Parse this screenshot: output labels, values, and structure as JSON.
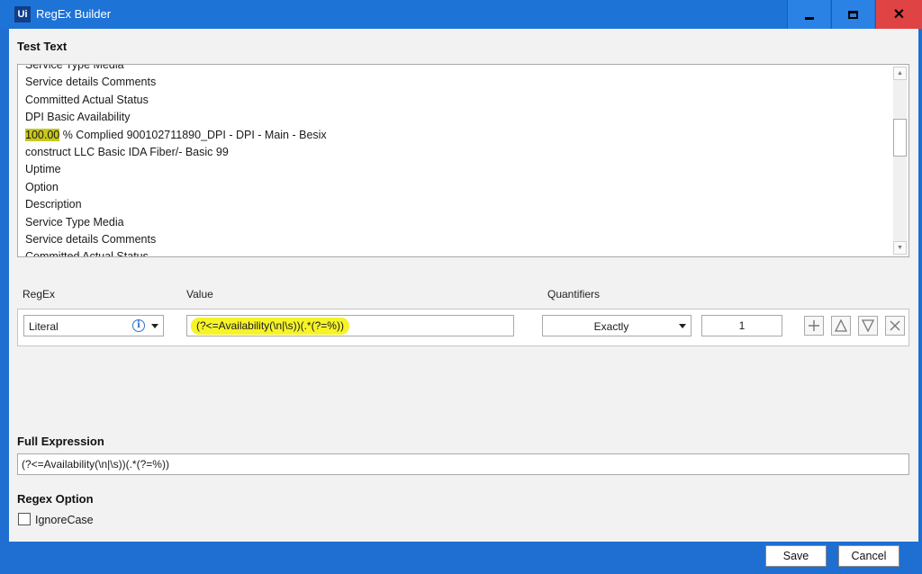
{
  "window": {
    "logo": "Ui",
    "title": "RegEx Builder"
  },
  "test_text": {
    "label": "Test Text",
    "lines": [
      "Service Type Media",
      "Service details Comments",
      "Committed Actual Status",
      "DPI Basic Availability",
      "",
      "construct LLC Basic IDA Fiber/- Basic 99",
      "Uptime",
      "Option",
      "Description",
      "Service Type Media",
      "Service details Comments",
      "Committed Actual Status"
    ],
    "match_line": {
      "highlight": "100.00",
      "rest": " % Complied 900102711890_DPI - DPI - Main - Besix"
    }
  },
  "columns": {
    "regex": "RegEx",
    "value": "Value",
    "quantifiers": "Quantifiers"
  },
  "row": {
    "regex_type": "Literal",
    "value": "(?<=Availability(\\n|\\s))(.*(?=%))",
    "quantifier": "Exactly",
    "count": "1"
  },
  "full_expression": {
    "label": "Full Expression",
    "value": "(?<=Availability(\\n|\\s))(.*(?=%))"
  },
  "regex_option": {
    "label": "Regex Option",
    "ignore_case_label": "IgnoreCase",
    "ignore_case_checked": false
  },
  "footer": {
    "save_label": "Save",
    "cancel_label": "Cancel"
  },
  "colors": {
    "titlebar": "#1e73d7",
    "close_button": "#e04343",
    "value_highlight": "#f6f32a",
    "match_highlight": "#c8c81c"
  }
}
